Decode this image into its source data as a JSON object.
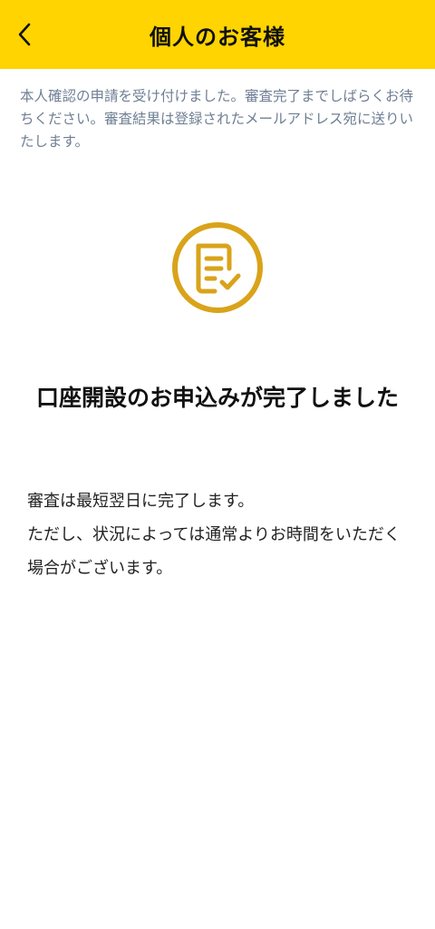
{
  "header": {
    "title": "個人のお客様",
    "back_icon": "chevron-left-icon"
  },
  "notice": "本人確認の申請を受け付けました。審査完了までしばらくお待ちください。審査結果は登録されたメールアドレス宛に送りいたします。",
  "status_icon": {
    "name": "document-check-icon",
    "color": "#D9A31A"
  },
  "complete_title": "口座開設のお申込みが完了しました",
  "message": {
    "line1": "審査は最短翌日に完了します。",
    "line2": "ただし、状況によっては通常よりお時間をいただく場合がございます。"
  },
  "colors": {
    "header_bg": "#FFD400",
    "notice_text": "#6f7f94",
    "icon_gold": "#D9A31A"
  }
}
